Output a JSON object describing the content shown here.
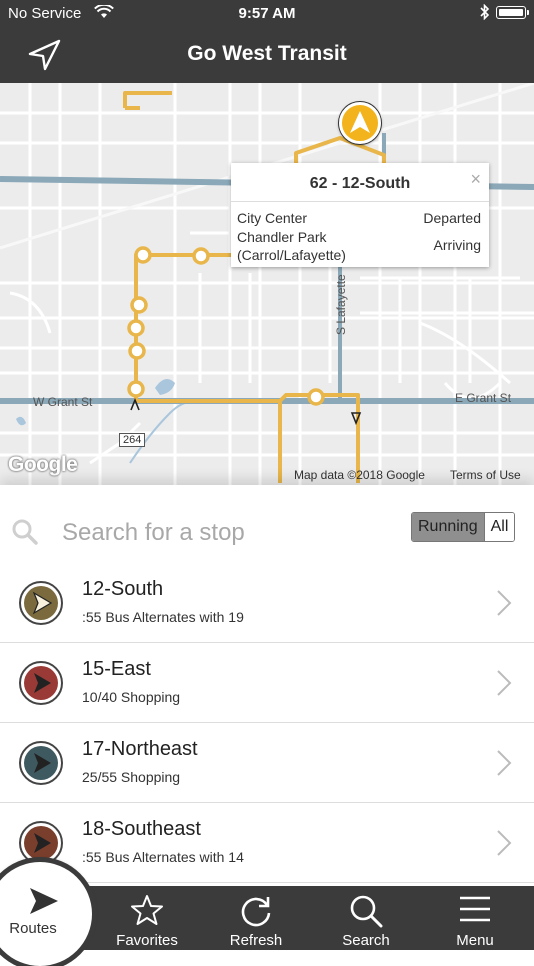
{
  "status": {
    "carrier": "No Service",
    "time": "9:57 AM"
  },
  "header": {
    "title": "Go West Transit"
  },
  "map": {
    "streets": {
      "grant_west": "W Grant St",
      "grant_east": "E Grant St",
      "lafayette": "S Lafayette",
      "route_shield": "264"
    },
    "google_logo": "Google",
    "attribution": "Map data ©2018 Google",
    "terms": "Terms of Use",
    "popup": {
      "title": "62 - 12-South",
      "close": "×",
      "stop1": "City Center",
      "status1": "Departed",
      "stop2": "Chandler Park (Carrol/Lafayette)",
      "status2": "Arriving"
    },
    "colors": {
      "route": "#e8b64a",
      "arterial": "#8aa8b8",
      "land": "#ececec",
      "road": "#ffffff"
    }
  },
  "search": {
    "placeholder": "Search for a stop",
    "filter_running": "Running",
    "filter_all": "All"
  },
  "routes": [
    {
      "name": "12-South",
      "desc": ":55 Bus Alternates with 19",
      "color": "#7a6a3e"
    },
    {
      "name": "15-East",
      "desc": "10/40 Shopping",
      "color": "#9a3a36"
    },
    {
      "name": "17-Northeast",
      "desc": "25/55 Shopping",
      "color": "#3e5a60"
    },
    {
      "name": "18-Southeast",
      "desc": ":55 Bus Alternates with 14",
      "color": "#7a3f2c"
    }
  ],
  "tabs": {
    "routes": "Routes",
    "favorites": "Favorites",
    "refresh": "Refresh",
    "search": "Search",
    "menu": "Menu"
  }
}
